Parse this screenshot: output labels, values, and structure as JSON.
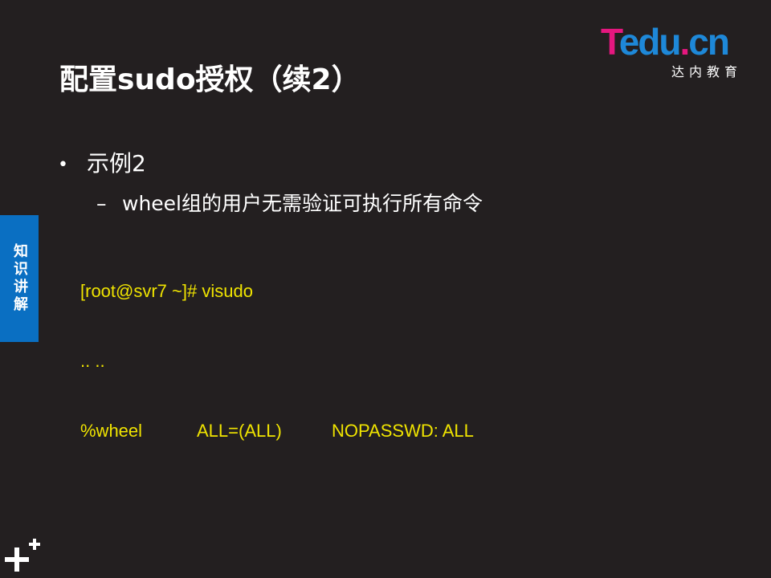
{
  "logo": {
    "brand_t": "T",
    "brand_edu": "edu",
    "brand_dot": ".",
    "brand_cn": "cn",
    "subtitle": "达内教育",
    "colors": {
      "pink": "#e5177f",
      "blue": "#1e88d8"
    }
  },
  "slide": {
    "title": "配置sudo授权（续2）",
    "bullet_level1": "示例2",
    "bullet_level2": "wheel组的用户无需验证可执行所有命令",
    "code": {
      "line1": "[root@svr7 ~]# visudo",
      "line2": ".. ..",
      "line3_col1": "%wheel",
      "line3_col2": "ALL=(ALL)",
      "line3_col3": "NOPASSWD: ALL"
    }
  },
  "side_tab": {
    "label": "知识讲解",
    "color": "#0a6fc2"
  },
  "colors": {
    "background": "#231f20",
    "code_text": "#f0e400"
  }
}
